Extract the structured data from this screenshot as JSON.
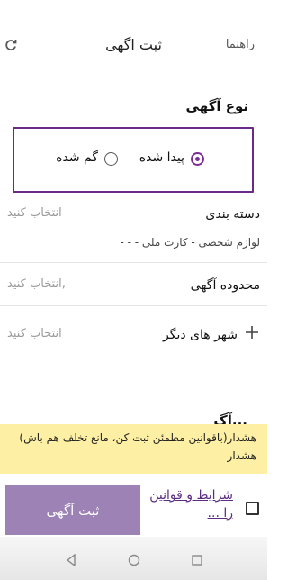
{
  "header": {
    "help_label": "راهنما",
    "title": "ثبت اگهی",
    "refresh_icon": "refresh-icon"
  },
  "ad_type": {
    "label": "نوع آگهی",
    "options": [
      {
        "label": "پیدا شده",
        "selected": true
      },
      {
        "label": "گم شده",
        "selected": false
      }
    ]
  },
  "category": {
    "label": "دسته بندی",
    "placeholder": "انتخاب کنید",
    "value": "لوازم شخصی - کارت ملی - - -"
  },
  "area": {
    "label": "محدوده آگهی",
    "placeholder": "انتخاب کنید,"
  },
  "other_cities": {
    "plus_icon": "plus-icon",
    "label": "شهر های دیگر",
    "placeholder": "انتخاب کنید"
  },
  "partial_heading": "...آگ",
  "warning_banner": {
    "text": "هشدار(باقوانین مطمئن ثبت کن، مانع تخلف هم باش) هشدار"
  },
  "footer": {
    "submit_label": "ثبت آگهی",
    "terms_label": "شرایط و قوانین را ..."
  },
  "colors": {
    "accent": "#7a2d93",
    "submit_bg": "#9c82b5",
    "banner_bg": "#fdf0a4"
  }
}
